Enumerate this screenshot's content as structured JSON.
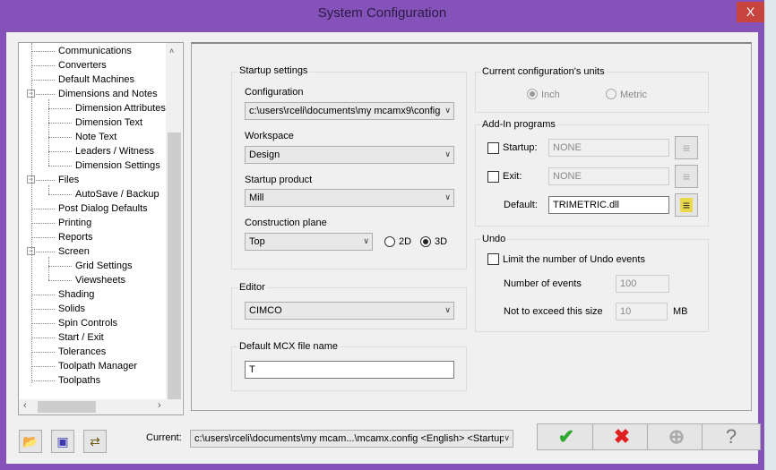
{
  "window": {
    "title": "System Configuration",
    "close": "X"
  },
  "tree": {
    "items": [
      {
        "label": "Communications",
        "level": 1
      },
      {
        "label": "Converters",
        "level": 1
      },
      {
        "label": "Default Machines",
        "level": 1
      },
      {
        "label": "Dimensions and Notes",
        "level": 1,
        "expanded": true
      },
      {
        "label": "Dimension Attributes",
        "level": 2
      },
      {
        "label": "Dimension Text",
        "level": 2
      },
      {
        "label": "Note Text",
        "level": 2
      },
      {
        "label": "Leaders / Witness",
        "level": 2
      },
      {
        "label": "Dimension Settings",
        "level": 2
      },
      {
        "label": "Files",
        "level": 1,
        "expanded": true
      },
      {
        "label": "AutoSave / Backup",
        "level": 2
      },
      {
        "label": "Post Dialog Defaults",
        "level": 1
      },
      {
        "label": "Printing",
        "level": 1
      },
      {
        "label": "Reports",
        "level": 1
      },
      {
        "label": "Screen",
        "level": 1,
        "expanded": true
      },
      {
        "label": "Grid Settings",
        "level": 2
      },
      {
        "label": "Viewsheets",
        "level": 2
      },
      {
        "label": "Shading",
        "level": 1
      },
      {
        "label": "Solids",
        "level": 1
      },
      {
        "label": "Spin Controls",
        "level": 1
      },
      {
        "label": "Start / Exit",
        "level": 1
      },
      {
        "label": "Tolerances",
        "level": 1
      },
      {
        "label": "Toolpath Manager",
        "level": 1
      },
      {
        "label": "Toolpaths",
        "level": 1
      }
    ]
  },
  "startup": {
    "title": "Startup settings",
    "config_label": "Configuration",
    "config_value": "c:\\users\\rceli\\documents\\my mcamx9\\config",
    "workspace_label": "Workspace",
    "workspace_value": "Design",
    "product_label": "Startup product",
    "product_value": "Mill",
    "plane_label": "Construction plane",
    "plane_value": "Top",
    "opt_2d": "2D",
    "opt_3d": "3D",
    "selected": "3D"
  },
  "editor": {
    "title": "Editor",
    "value": "CIMCO"
  },
  "mcx": {
    "title": "Default MCX file name",
    "value": "T"
  },
  "units": {
    "title": "Current configuration's units",
    "inch": "Inch",
    "metric": "Metric",
    "selected": "Inch"
  },
  "addin": {
    "title": "Add-In programs",
    "startup_label": "Startup:",
    "startup_value": "NONE",
    "startup_checked": false,
    "exit_label": "Exit:",
    "exit_value": "NONE",
    "exit_checked": false,
    "default_label": "Default:",
    "default_value": "TRIMETRIC.dll"
  },
  "undo": {
    "title": "Undo",
    "limit_label": "Limit the number of Undo events",
    "limit_checked": false,
    "events_label": "Number of events",
    "events_value": "100",
    "size_label": "Not to exceed this size",
    "size_value": "10",
    "size_unit": "MB"
  },
  "footer": {
    "current_label": "Current:",
    "current_value": "c:\\users\\rceli\\documents\\my mcam...\\mcamx.config <English> <Startup>"
  },
  "colors": {
    "frame": "#8452b8",
    "ok": "#2ea82e",
    "cancel": "#e02020"
  }
}
